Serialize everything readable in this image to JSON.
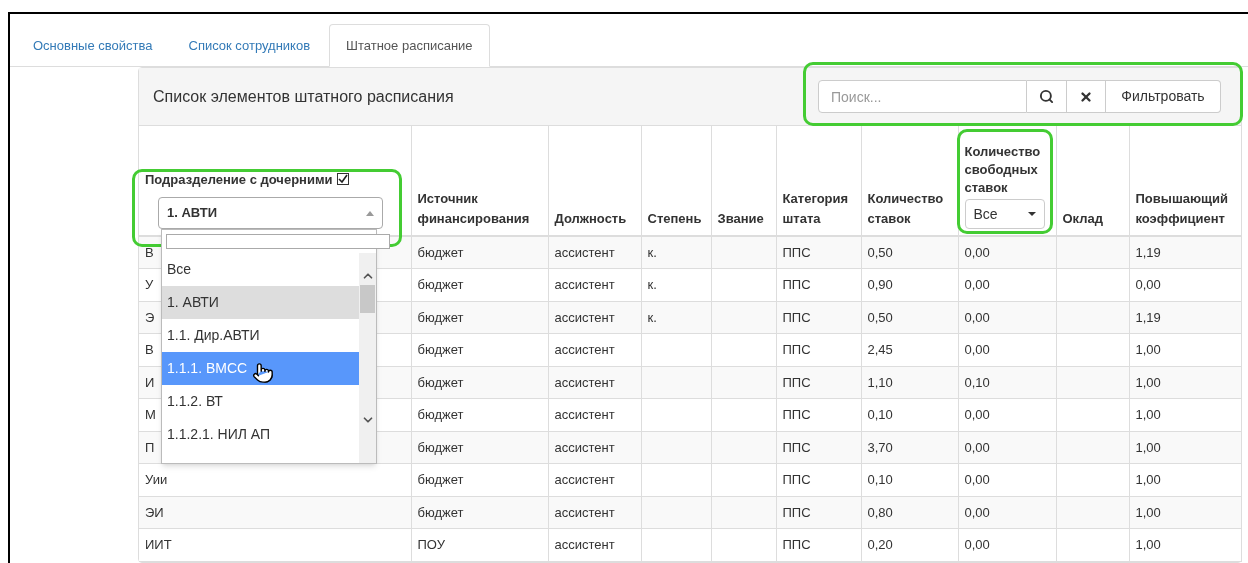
{
  "tabs": [
    {
      "label": "Основные свойства",
      "selected": false
    },
    {
      "label": "Список сотрудников",
      "selected": false
    },
    {
      "label": "Штатное расписание",
      "selected": true
    }
  ],
  "panel": {
    "title": "Список элементов штатного расписания",
    "search": {
      "placeholder": "Поиск..."
    },
    "filter_button": "Фильтровать"
  },
  "table": {
    "columns": [
      {
        "kind": "subdivision",
        "label": "Подразделение с дочерними",
        "checked": true,
        "value": "1. АВТИ"
      },
      {
        "kind": "plain",
        "label": "Источник финансирования"
      },
      {
        "kind": "plain",
        "label": "Должность"
      },
      {
        "kind": "plain",
        "label": "Степень"
      },
      {
        "kind": "plain",
        "label": "Звание"
      },
      {
        "kind": "plain",
        "label": "Категория штата"
      },
      {
        "kind": "plain",
        "label": "Количество ставок"
      },
      {
        "kind": "select",
        "label": "Количество свободных ставок",
        "value": "Все"
      },
      {
        "kind": "plain",
        "label": "Оклад"
      },
      {
        "kind": "plain",
        "label": "Повышающий коэффициент"
      }
    ],
    "rows": [
      [
        "В",
        "бюджет",
        "ассистент",
        "к.",
        null,
        "ППС",
        "0,50",
        "0,00",
        null,
        "1,19"
      ],
      [
        "У",
        "бюджет",
        "ассистент",
        "к.",
        null,
        "ППС",
        "0,90",
        "0,00",
        null,
        "0,00"
      ],
      [
        "Э",
        "бюджет",
        "ассистент",
        "к.",
        null,
        "ППС",
        "0,50",
        "0,00",
        null,
        "1,19"
      ],
      [
        "В",
        "бюджет",
        "ассистент",
        null,
        null,
        "ППС",
        "2,45",
        "0,00",
        null,
        "1,00"
      ],
      [
        "И",
        "бюджет",
        "ассистент",
        null,
        null,
        "ППС",
        "1,10",
        "0,10",
        null,
        "1,00"
      ],
      [
        "М",
        "бюджет",
        "ассистент",
        null,
        null,
        "ППС",
        "0,10",
        "0,00",
        null,
        "1,00"
      ],
      [
        "П",
        "бюджет",
        "ассистент",
        null,
        null,
        "ППС",
        "3,70",
        "0,00",
        null,
        "1,00"
      ],
      [
        "Уии",
        "бюджет",
        "ассистент",
        null,
        null,
        "ППС",
        "0,10",
        "0,00",
        null,
        "1,00"
      ],
      [
        "ЭИ",
        "бюджет",
        "ассистент",
        null,
        null,
        "ППС",
        "0,80",
        "0,00",
        null,
        "1,00"
      ],
      [
        "ИИТ",
        "ПОУ",
        "ассистент",
        null,
        null,
        "ППС",
        "0,20",
        "0,00",
        null,
        "1,00"
      ]
    ]
  },
  "dropdown": {
    "options": [
      {
        "label": "Все",
        "selected": false,
        "hovered": false
      },
      {
        "label": "1. АВТИ",
        "selected": true,
        "hovered": false
      },
      {
        "label": "1.1. Дир.АВТИ",
        "selected": false,
        "hovered": false
      },
      {
        "label": "1.1.1. ВМСС",
        "selected": false,
        "hovered": true
      },
      {
        "label": "1.1.2. ВТ",
        "selected": false,
        "hovered": false
      },
      {
        "label": "1.1.2.1. НИЛ АП",
        "selected": false,
        "hovered": false
      }
    ]
  }
}
